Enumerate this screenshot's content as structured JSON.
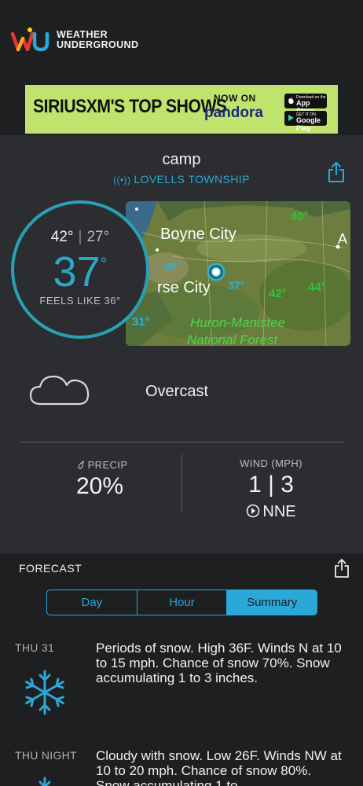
{
  "header": {
    "logo_line1": "WEATHER",
    "logo_line2": "UNDERGROUND",
    "logo_letters": "wu"
  },
  "ad": {
    "headline": "SIRIUSXM'S TOP SHOWS",
    "now_on": "NOW ON",
    "brand": "pandora",
    "badge_apple_small": "Download on the",
    "badge_apple": "App Store",
    "badge_google_small": "GET IT ON",
    "badge_google": "Google Play"
  },
  "location": {
    "name": "camp",
    "station": "LOVELLS TOWNSHIP",
    "station_icon": "signal-icon",
    "share_icon": "share-icon"
  },
  "map": {
    "labels": [
      "Boyne City",
      "rse City",
      "Huron-Manistee",
      "National Forest",
      "A"
    ],
    "temps": [
      "40°",
      "35°",
      "37°",
      "42°",
      "44°",
      "31°"
    ]
  },
  "current": {
    "high": "42°",
    "low": "27°",
    "temp": "37",
    "degree": "°",
    "feels_like": "FEELS LIKE 36°",
    "condition": "Overcast",
    "condition_icon": "cloud-icon"
  },
  "stats": {
    "precip_label": "PRECIP",
    "precip_value": "20%",
    "wind_label": "WIND (MPH)",
    "wind_value": "1 | 3",
    "wind_dir": "NNE"
  },
  "forecast": {
    "title": "FORECAST",
    "tabs": [
      {
        "label": "Day",
        "active": false
      },
      {
        "label": "Hour",
        "active": false
      },
      {
        "label": "Summary",
        "active": true
      }
    ],
    "items": [
      {
        "day": "THU 31",
        "text": "Periods of snow. High 36F. Winds N at 10 to 15 mph. Chance of snow 70%. Snow accumulating 1 to 3 inches.",
        "icon": "snowflake-icon"
      },
      {
        "day": "THU NIGHT",
        "text": "Cloudy with snow. Low 26F. Winds NW at 10 to 20 mph. Chance of snow 80%. Snow accumulating 1 to",
        "icon": "snowflake-icon"
      }
    ]
  },
  "colors": {
    "accent": "#2aa8d8",
    "ring": "#2a9fb6",
    "ad_bg": "#bfe36c",
    "panel": "#2b2d30",
    "bg": "#1e1f21"
  }
}
